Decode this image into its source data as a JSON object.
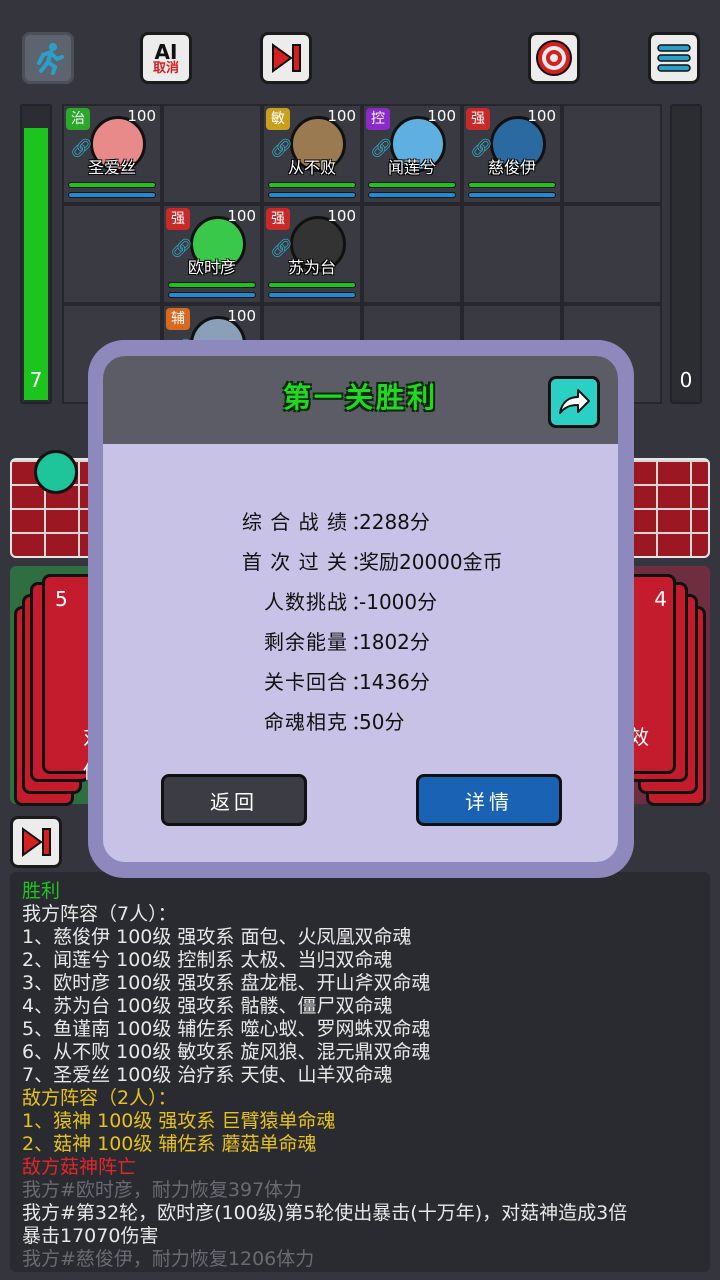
{
  "toolbar": {
    "ai_label": "AI",
    "ai_sub": "取消"
  },
  "gauges": {
    "left_value": "7",
    "right_value": "0",
    "left_fill_fraction": 0.92
  },
  "heroes": [
    {
      "type": "治",
      "type_color": "#2aa82a",
      "level": "100",
      "name": "圣爱丝",
      "face": "#e88a8a",
      "col": 1,
      "row": 1
    },
    {
      "type": "敏",
      "type_color": "#c8a020",
      "level": "100",
      "name": "从不败",
      "face": "#9a7a50",
      "col": 3,
      "row": 1
    },
    {
      "type": "控",
      "type_color": "#8a2ac8",
      "level": "100",
      "name": "闻莲兮",
      "face": "#5fb0e0",
      "col": 4,
      "row": 1
    },
    {
      "type": "强",
      "type_color": "#c82a2a",
      "level": "100",
      "name": "慈俊伊",
      "face": "#2a6aa0",
      "col": 5,
      "row": 1
    },
    {
      "type": "强",
      "type_color": "#c82a2a",
      "level": "100",
      "name": "欧时彦",
      "face": "#3ac84a",
      "col": 2,
      "row": 2
    },
    {
      "type": "强",
      "type_color": "#c82a2a",
      "level": "100",
      "name": "苏为台",
      "face": "#333333",
      "col": 3,
      "row": 2
    },
    {
      "type": "辅",
      "type_color": "#d86a20",
      "level": "100",
      "name": "",
      "face": "#8aa0b8",
      "col": 2,
      "row": 3
    }
  ],
  "cards": {
    "left_count": "5",
    "right_count": "4",
    "left_text_1": "对",
    "left_text_2": "伤",
    "right_text": "效"
  },
  "modal": {
    "title": "第一关胜利",
    "stats": [
      {
        "label": "综 合 战 绩",
        "value": "2288分"
      },
      {
        "label": "首 次 过 关",
        "value": "奖励20000金币"
      },
      {
        "label": "人数挑战",
        "value": "-1000分"
      },
      {
        "label": "剩余能量",
        "value": "1802分"
      },
      {
        "label": "关卡回合",
        "value": "1436分"
      },
      {
        "label": "命魂相克",
        "value": "50分"
      }
    ],
    "back_label": "返回",
    "detail_label": "详情"
  },
  "log": [
    {
      "text": "胜利",
      "color": "green"
    },
    {
      "text": "我方阵容（7人）：",
      "color": "white"
    },
    {
      "text": "1、慈俊伊 100级 强攻系 面包、火凤凰双命魂",
      "color": "white"
    },
    {
      "text": "2、闻莲兮 100级 控制系 太极、当归双命魂",
      "color": "white"
    },
    {
      "text": "3、欧时彦 100级 强攻系 盘龙棍、开山斧双命魂",
      "color": "white"
    },
    {
      "text": "4、苏为台 100级 强攻系 骷髅、僵尸双命魂",
      "color": "white"
    },
    {
      "text": "5、鱼谨南 100级 辅佐系 噬心蚁、罗网蛛双命魂",
      "color": "white"
    },
    {
      "text": "6、从不败 100级 敏攻系 旋风狼、混元鼎双命魂",
      "color": "white"
    },
    {
      "text": "7、圣爱丝 100级 治疗系 天使、山羊双命魂",
      "color": "white"
    },
    {
      "text": "敌方阵容（2人）：",
      "color": "yellow"
    },
    {
      "text": "1、猿神 100级 强攻系 巨臂猿单命魂",
      "color": "yellow"
    },
    {
      "text": "2、菇神 100级 辅佐系 蘑菇单命魂",
      "color": "yellow"
    },
    {
      "text": "敌方菇神阵亡",
      "color": "red"
    },
    {
      "text": "我方#欧时彦，耐力恢复397体力",
      "color": "grey"
    },
    {
      "text": "我方#第32轮，欧时彦(100级)第5轮使出暴击(十万年)，对菇神造成3倍",
      "color": "white"
    },
    {
      "text": "暴击17070伤害",
      "color": "white"
    },
    {
      "text": "我方#慈俊伊，耐力恢复1206体力",
      "color": "grey"
    }
  ]
}
